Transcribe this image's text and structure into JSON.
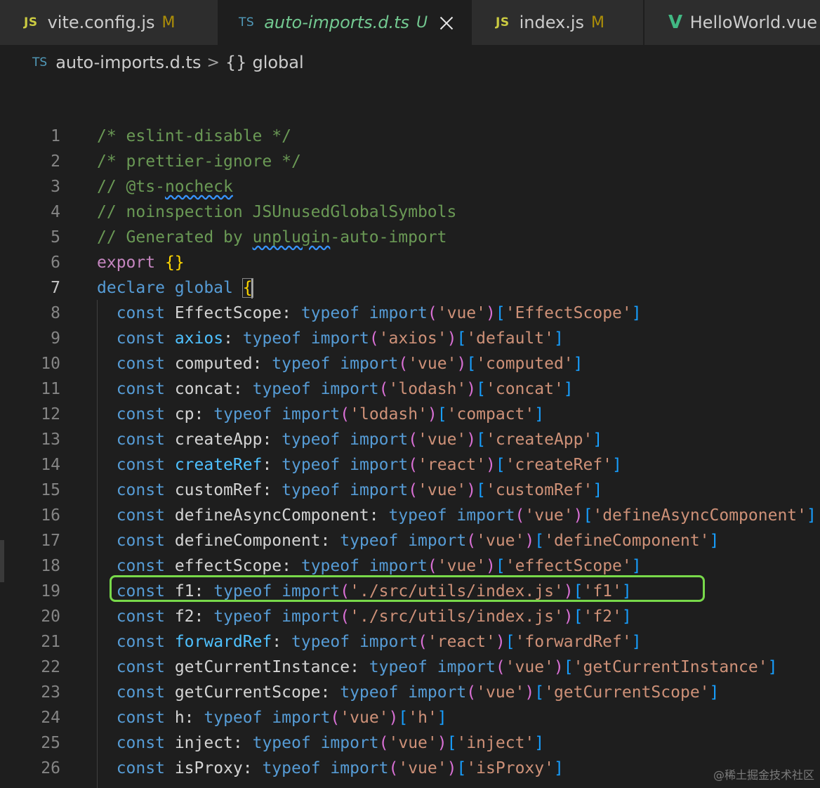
{
  "tabs": [
    {
      "icon": "JS",
      "name": "vite.config.js",
      "status": "M",
      "active": false
    },
    {
      "icon": "TS",
      "name": "auto-imports.d.ts",
      "status": "U",
      "active": true
    },
    {
      "icon": "JS",
      "name": "index.js",
      "status": "M",
      "active": false
    },
    {
      "icon": "V",
      "name": "HelloWorld.vue",
      "status": "",
      "active": false
    }
  ],
  "breadcrumb": {
    "file_icon": "TS",
    "file": "auto-imports.d.ts",
    "separator": ">",
    "symbol_icon": "{}",
    "symbol": "global"
  },
  "editor": {
    "active_line": 7,
    "highlighted_line": 19,
    "lines": [
      {
        "n": "1",
        "text": "/* eslint-disable */"
      },
      {
        "n": "2",
        "text": "/* prettier-ignore */"
      },
      {
        "n": "3",
        "text": "// @ts-nocheck"
      },
      {
        "n": "4",
        "text": "// noinspection JSUnusedGlobalSymbols"
      },
      {
        "n": "5",
        "text": "// Generated by unplugin-auto-import"
      },
      {
        "n": "6",
        "text": "export {}"
      },
      {
        "n": "7",
        "text": "declare global {"
      },
      {
        "n": "8",
        "text": "  const EffectScope: typeof import('vue')['EffectScope']"
      },
      {
        "n": "9",
        "text": "  const axios: typeof import('axios')['default']"
      },
      {
        "n": "10",
        "text": "  const computed: typeof import('vue')['computed']"
      },
      {
        "n": "11",
        "text": "  const concat: typeof import('lodash')['concat']"
      },
      {
        "n": "12",
        "text": "  const cp: typeof import('lodash')['compact']"
      },
      {
        "n": "13",
        "text": "  const createApp: typeof import('vue')['createApp']"
      },
      {
        "n": "14",
        "text": "  const createRef: typeof import('react')['createRef']"
      },
      {
        "n": "15",
        "text": "  const customRef: typeof import('vue')['customRef']"
      },
      {
        "n": "16",
        "text": "  const defineAsyncComponent: typeof import('vue')['defineAsyncComponent']"
      },
      {
        "n": "17",
        "text": "  const defineComponent: typeof import('vue')['defineComponent']"
      },
      {
        "n": "18",
        "text": "  const effectScope: typeof import('vue')['effectScope']"
      },
      {
        "n": "19",
        "text": "  const f1: typeof import('./src/utils/index.js')['f1']"
      },
      {
        "n": "20",
        "text": "  const f2: typeof import('./src/utils/index.js')['f2']"
      },
      {
        "n": "21",
        "text": "  const forwardRef: typeof import('react')['forwardRef']"
      },
      {
        "n": "22",
        "text": "  const getCurrentInstance: typeof import('vue')['getCurrentInstance']"
      },
      {
        "n": "23",
        "text": "  const getCurrentScope: typeof import('vue')['getCurrentScope']"
      },
      {
        "n": "24",
        "text": "  const h: typeof import('vue')['h']"
      },
      {
        "n": "25",
        "text": "  const inject: typeof import('vue')['inject']"
      },
      {
        "n": "26",
        "text": "  const isProxy: typeof import('vue')['isProxy']"
      }
    ]
  },
  "watermark": "@稀土掘金技术社区",
  "colors": {
    "comment": "#6a9955",
    "keyword": "#569cd6",
    "string": "#ce9178",
    "identifier": "#9cdcfe",
    "highlight_border": "#78d94a"
  }
}
